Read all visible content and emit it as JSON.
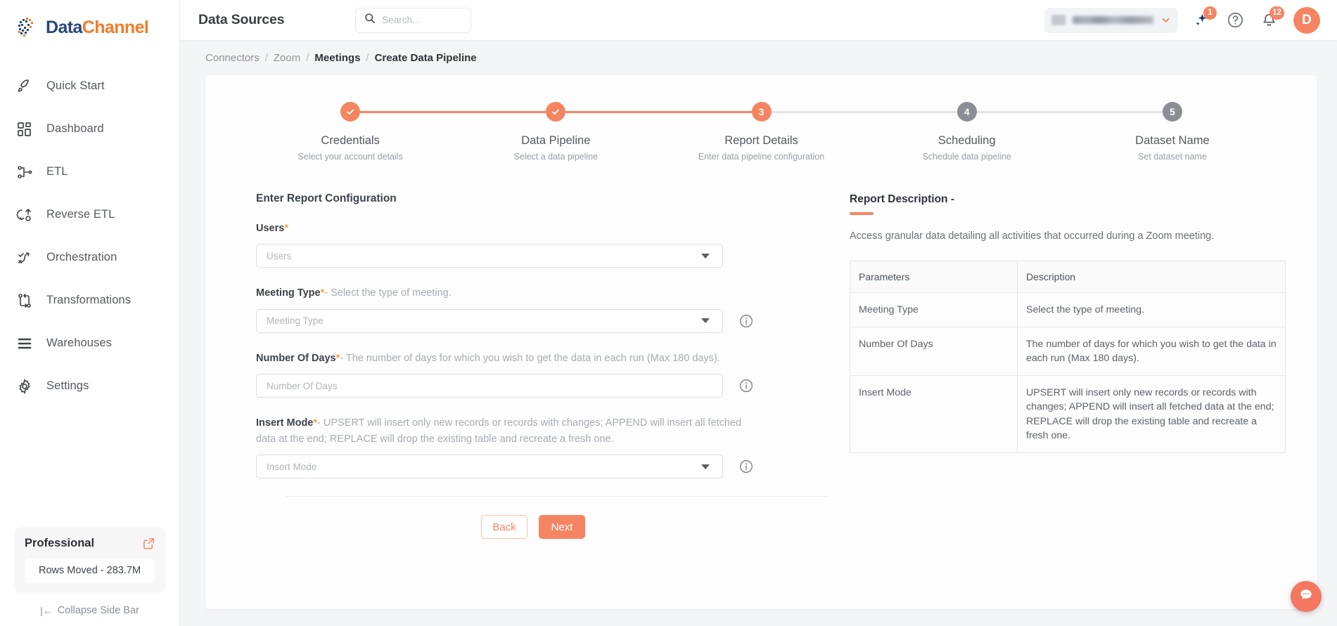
{
  "sidebar": {
    "logo": {
      "part1": "Data",
      "part2": "Channel",
      "icon": "globe-pixel-icon"
    },
    "items": [
      {
        "label": "Quick Start",
        "icon": "rocket-icon"
      },
      {
        "label": "Dashboard",
        "icon": "grid-icon"
      },
      {
        "label": "ETL",
        "icon": "etl-branch-icon"
      },
      {
        "label": "Reverse ETL",
        "icon": "reverse-etl-icon"
      },
      {
        "label": "Orchestration",
        "icon": "orchestration-icon"
      },
      {
        "label": "Transformations",
        "icon": "transformations-icon"
      },
      {
        "label": "Warehouses",
        "icon": "warehouse-stack-icon"
      },
      {
        "label": "Settings",
        "icon": "gear-icon"
      }
    ],
    "plan": {
      "name": "Professional",
      "external_icon": "external-link-icon",
      "rows_moved": "Rows Moved - 283.7M"
    },
    "collapse": {
      "arrow": "|←",
      "label": "Collapse Side Bar"
    }
  },
  "topbar": {
    "title": "Data Sources",
    "search": {
      "placeholder": "Search...",
      "value": "",
      "icon": "search-icon"
    },
    "org_selector": {
      "caret_icon": "chevron-down-icon"
    },
    "ai_button": {
      "icon": "sparkle-icon",
      "badge": "1"
    },
    "help_button": {
      "icon": "question-circle-icon"
    },
    "notifications": {
      "icon": "bell-icon",
      "badge": "12"
    },
    "avatar": {
      "initial": "D"
    }
  },
  "breadcrumb": {
    "items": [
      "Connectors",
      "Zoom",
      "Meetings",
      "Create Data Pipeline"
    ],
    "separator": "/"
  },
  "stepper": {
    "steps": [
      {
        "n": "1",
        "title": "Credentials",
        "sub": "Select your account details",
        "state": "done"
      },
      {
        "n": "2",
        "title": "Data Pipeline",
        "sub": "Select a data pipeline",
        "state": "done"
      },
      {
        "n": "3",
        "title": "Report Details",
        "sub": "Enter data pipeline configuration",
        "state": "active"
      },
      {
        "n": "4",
        "title": "Scheduling",
        "sub": "Schedule data pipeline",
        "state": "todo"
      },
      {
        "n": "5",
        "title": "Dataset Name",
        "sub": "Set dataset name",
        "state": "todo"
      }
    ]
  },
  "form": {
    "heading": "Enter Report Configuration",
    "fields": [
      {
        "name": "Users",
        "star": "*",
        "hint": "",
        "placeholder": "Users",
        "type": "select",
        "value": "",
        "info": false
      },
      {
        "name": "Meeting Type",
        "star": "*",
        "hint": "- Select the type of meeting.",
        "placeholder": "Meeting Type",
        "type": "select",
        "value": "",
        "info": true
      },
      {
        "name": "Number Of Days",
        "star": "*",
        "hint": "- The number of days for which you wish to get the data in each run (Max 180 days).",
        "placeholder": "Number Of Days",
        "type": "text",
        "value": "",
        "info": true
      },
      {
        "name": "Insert Mode",
        "star": "*",
        "hint": "- UPSERT will insert only new records or records with changes; APPEND will insert all fetched data at the end; REPLACE will drop the existing table and recreate a fresh one.",
        "placeholder": "Insert Mode",
        "type": "select",
        "value": "",
        "info": true
      }
    ],
    "back_label": "Back",
    "next_label": "Next"
  },
  "report_description": {
    "title": "Report Description -",
    "intro": "Access granular data detailing all activities that occurred during a Zoom meeting.",
    "columns": [
      "Parameters",
      "Description"
    ],
    "rows": [
      {
        "parameter": "Meeting Type",
        "description": "Select the type of meeting."
      },
      {
        "parameter": "Number Of Days",
        "description": "The number of days for which you wish to get the data in each run (Max 180 days)."
      },
      {
        "parameter": "Insert Mode",
        "description": "UPSERT will insert only new records or records with changes; APPEND will insert all fetched data at the end; REPLACE will drop the existing table and recreate a fresh one."
      }
    ]
  },
  "chat_widget": {
    "icon": "chat-bubble-icon"
  },
  "colors": {
    "accent": "#f58562",
    "accent_dark": "#f4775f",
    "brand_navy": "#27477d",
    "brand_orange": "#f47b26",
    "star": "#f6a03c"
  }
}
